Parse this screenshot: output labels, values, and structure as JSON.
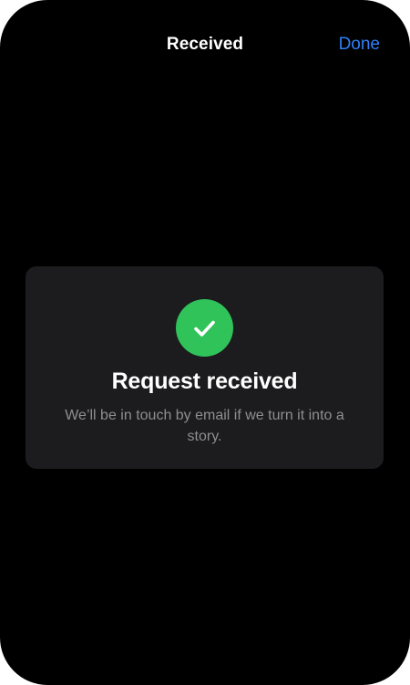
{
  "header": {
    "title": "Received",
    "done_label": "Done"
  },
  "confirmation": {
    "icon": "checkmark-icon",
    "title": "Request received",
    "message": "We’ll be in touch by email if we turn it into a story."
  },
  "colors": {
    "background": "#000000",
    "card": "#1c1c1e",
    "accent_link": "#2f7ff6",
    "success": "#30c35a",
    "secondary_text": "#8e8e93"
  }
}
